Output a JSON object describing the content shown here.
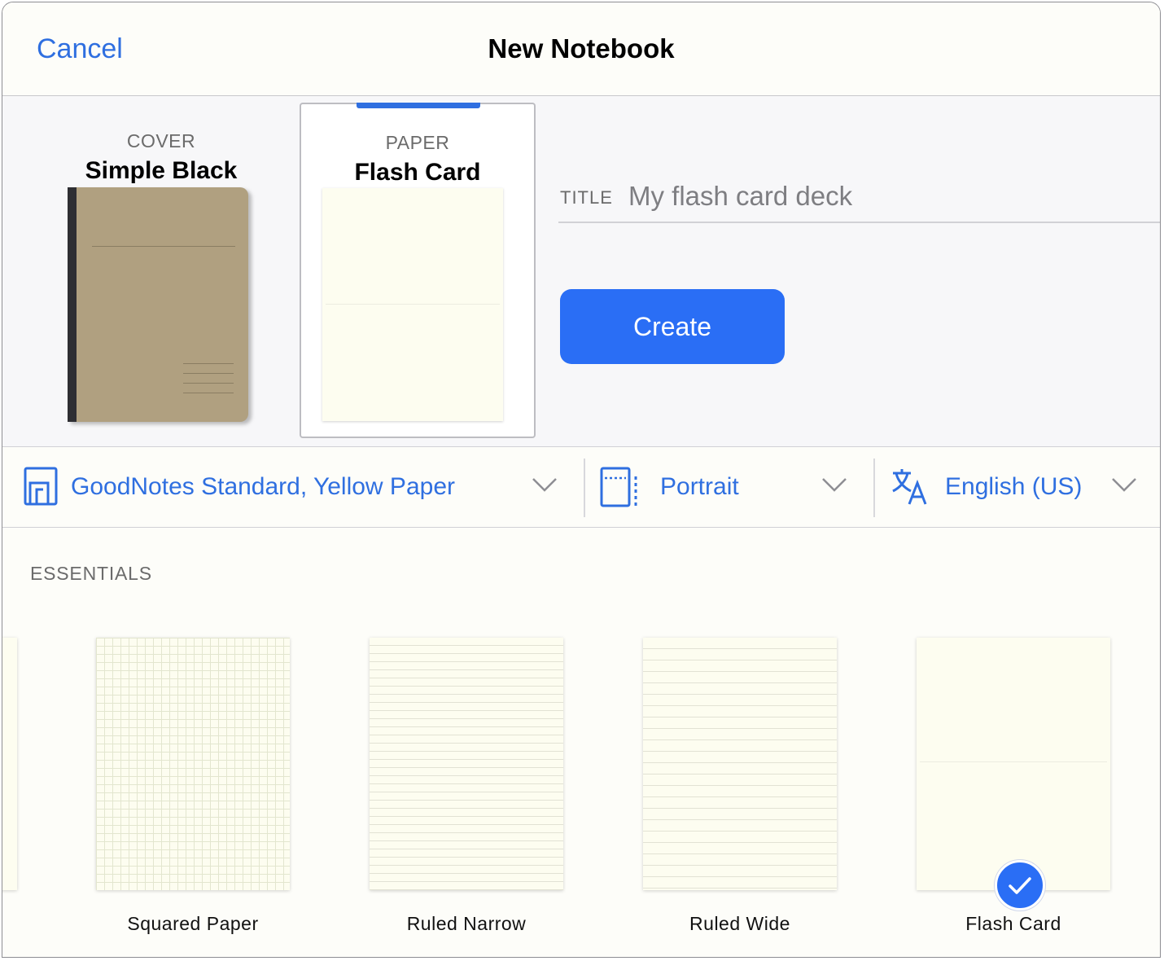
{
  "header": {
    "cancel_label": "Cancel",
    "title": "New Notebook"
  },
  "cover": {
    "kicker": "COVER",
    "name": "Simple Black"
  },
  "paper": {
    "kicker": "PAPER",
    "name": "Flash Card"
  },
  "title_field": {
    "label": "TITLE",
    "placeholder": "My flash card deck"
  },
  "create_label": "Create",
  "selectors": {
    "template": "GoodNotes Standard, Yellow Paper",
    "orientation": "Portrait",
    "language": "English (US)"
  },
  "essentials": {
    "heading": "ESSENTIALS",
    "items": [
      {
        "label": "Squared Paper",
        "selected": false
      },
      {
        "label": "Ruled Narrow",
        "selected": false
      },
      {
        "label": "Ruled Wide",
        "selected": false
      },
      {
        "label": "Flash Card",
        "selected": true
      }
    ]
  },
  "colors": {
    "accent": "#2a6ef5",
    "link": "#2f6fe0",
    "cover": "#b0a080",
    "paper": "#fdfdf0"
  }
}
